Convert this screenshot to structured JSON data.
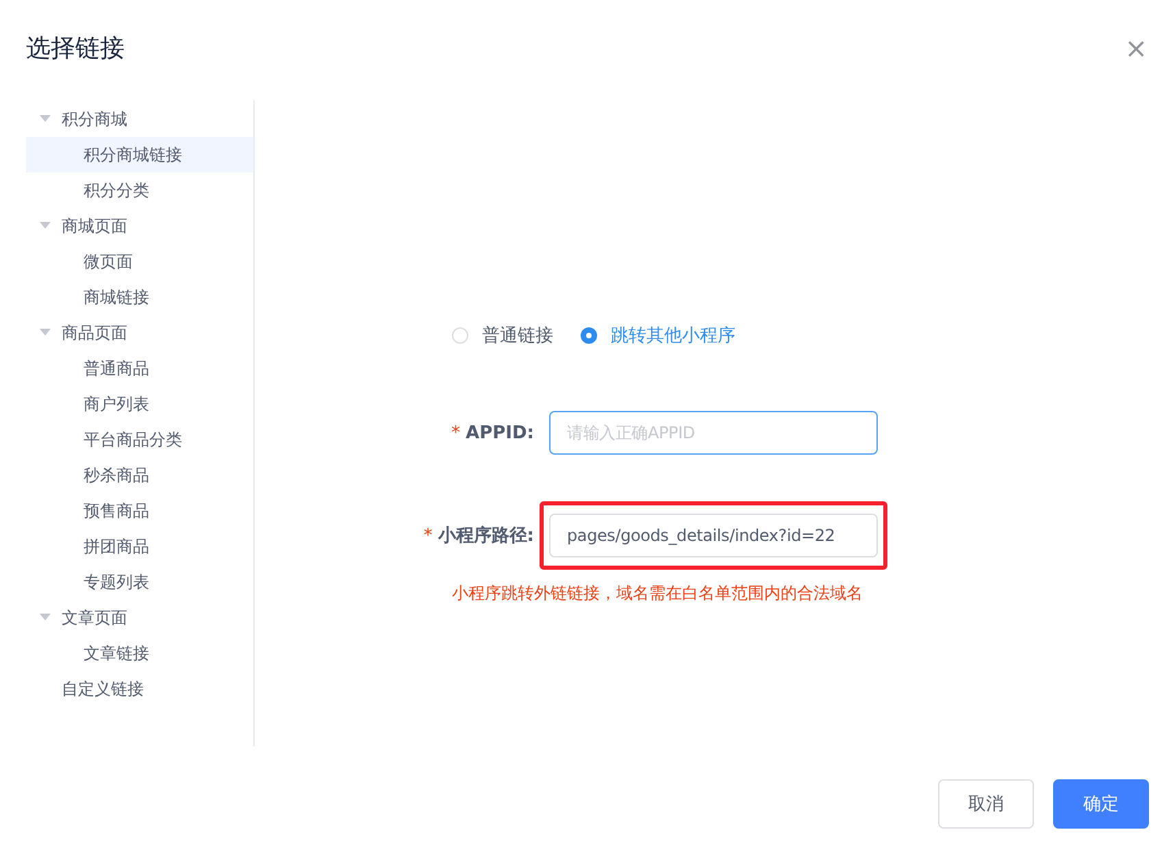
{
  "dialog": {
    "title": "选择链接",
    "close": "×"
  },
  "tree": [
    {
      "label": "积分商城",
      "expanded": true,
      "children": [
        {
          "label": "积分商城链接",
          "selected": true
        },
        {
          "label": "积分分类",
          "selected": false
        }
      ]
    },
    {
      "label": "商城页面",
      "expanded": true,
      "children": [
        {
          "label": "微页面",
          "selected": false
        },
        {
          "label": "商城链接",
          "selected": false
        }
      ]
    },
    {
      "label": "商品页面",
      "expanded": true,
      "children": [
        {
          "label": "普通商品",
          "selected": false
        },
        {
          "label": "商户列表",
          "selected": false
        },
        {
          "label": "平台商品分类",
          "selected": false
        },
        {
          "label": "秒杀商品",
          "selected": false
        },
        {
          "label": "预售商品",
          "selected": false
        },
        {
          "label": "拼团商品",
          "selected": false
        },
        {
          "label": "专题列表",
          "selected": false
        }
      ]
    },
    {
      "label": "文章页面",
      "expanded": true,
      "children": [
        {
          "label": "文章链接",
          "selected": false
        }
      ]
    },
    {
      "label": "自定义链接",
      "selected": false
    }
  ],
  "link_type": [
    {
      "label": "普通链接",
      "selected": false
    },
    {
      "label": "跳转其他小程序",
      "selected": true
    }
  ],
  "fields": [
    {
      "label": "APPID:",
      "required_mark": "*",
      "placeholder": "请输入正确APPID",
      "focused": true,
      "highlighted": false
    },
    {
      "label": "小程序路径:",
      "required_mark": "*",
      "value": "pages/goods_details/index?id=22",
      "focused": false,
      "highlighted": true
    }
  ],
  "hint": "小程序跳转外链链接，域名需在白名单范围内的合法域名",
  "buttons": [
    {
      "label": "取消",
      "kind": "secondary"
    },
    {
      "label": "确定",
      "kind": "primary"
    }
  ]
}
